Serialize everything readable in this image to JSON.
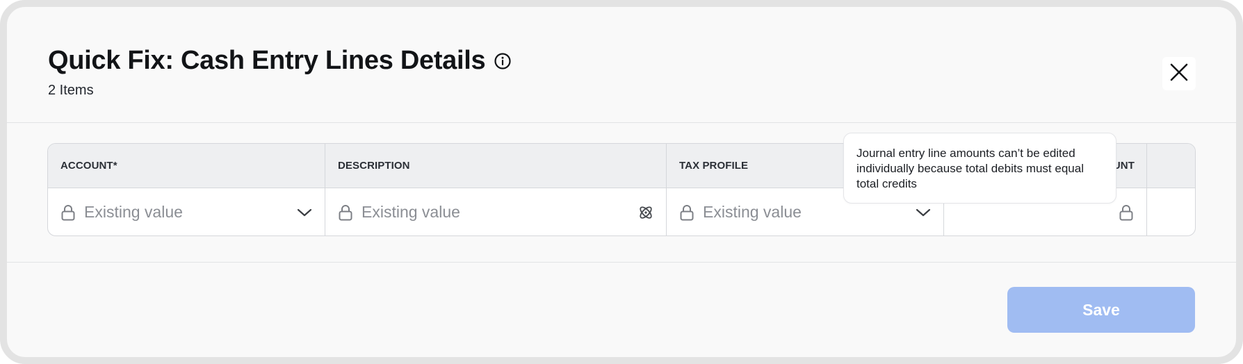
{
  "modal": {
    "title": "Quick Fix: Cash Entry Lines Details",
    "subtitle": "2 Items",
    "info_icon": "info-circle-icon",
    "close_icon": "close-icon"
  },
  "table": {
    "headers": [
      "ACCOUNT*",
      "DESCRIPTION",
      "TAX PROFILE",
      "UNT"
    ],
    "row": {
      "account_value": "Existing value",
      "description_value": "Existing value",
      "tax_profile_value": "Existing value",
      "amount_value": ""
    }
  },
  "tooltip": {
    "text": "Journal entry line amounts can’t be edited individually because total debits must equal total credits"
  },
  "footer": {
    "save_label": "Save"
  },
  "colors": {
    "save_disabled": "#a0bcf2",
    "header_bg": "#eeeff1",
    "placeholder_text": "#8b8e94"
  }
}
